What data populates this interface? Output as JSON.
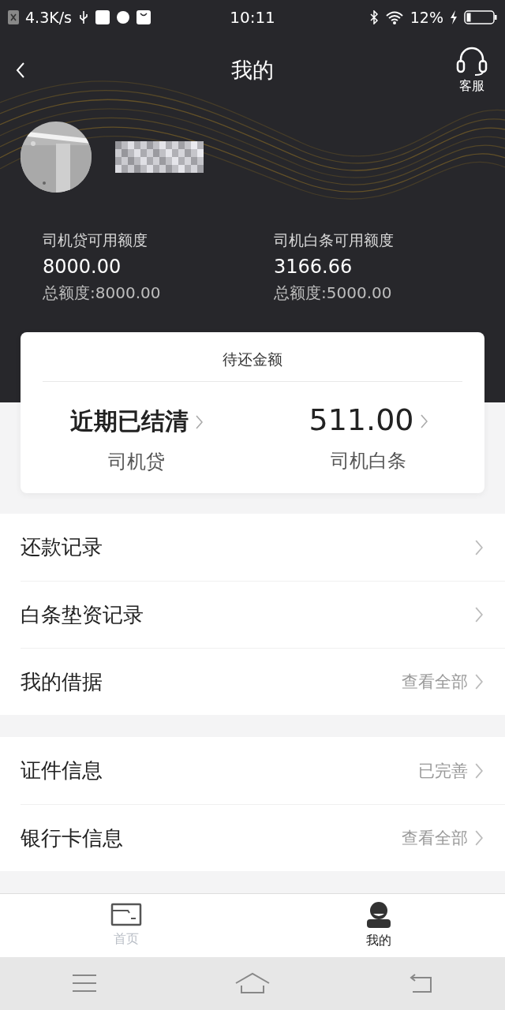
{
  "status_bar": {
    "network_speed": "4.3K/s",
    "time": "10:11",
    "battery": "12%"
  },
  "header": {
    "title": "我的",
    "service_label": "客服"
  },
  "credits": [
    {
      "label": "司机贷可用额度",
      "amount": "8000.00",
      "total": "总额度:8000.00"
    },
    {
      "label": "司机白条可用额度",
      "amount": "3166.66",
      "total": "总额度:5000.00"
    }
  ],
  "repay": {
    "title": "待还金额",
    "items": [
      {
        "kind": "text",
        "value": "近期已结清",
        "label": "司机贷"
      },
      {
        "kind": "amount",
        "value": "511.00",
        "label": "司机白条"
      }
    ]
  },
  "menu_groups": [
    [
      {
        "label": "还款记录"
      },
      {
        "label": "白条垫资记录"
      },
      {
        "label": "我的借据",
        "value": "查看全部"
      }
    ],
    [
      {
        "label": "证件信息",
        "value": "已完善"
      },
      {
        "label": "银行卡信息",
        "value": "查看全部"
      }
    ]
  ],
  "tabs": [
    {
      "label": "首页",
      "selected": false
    },
    {
      "label": "我的",
      "selected": true
    }
  ]
}
